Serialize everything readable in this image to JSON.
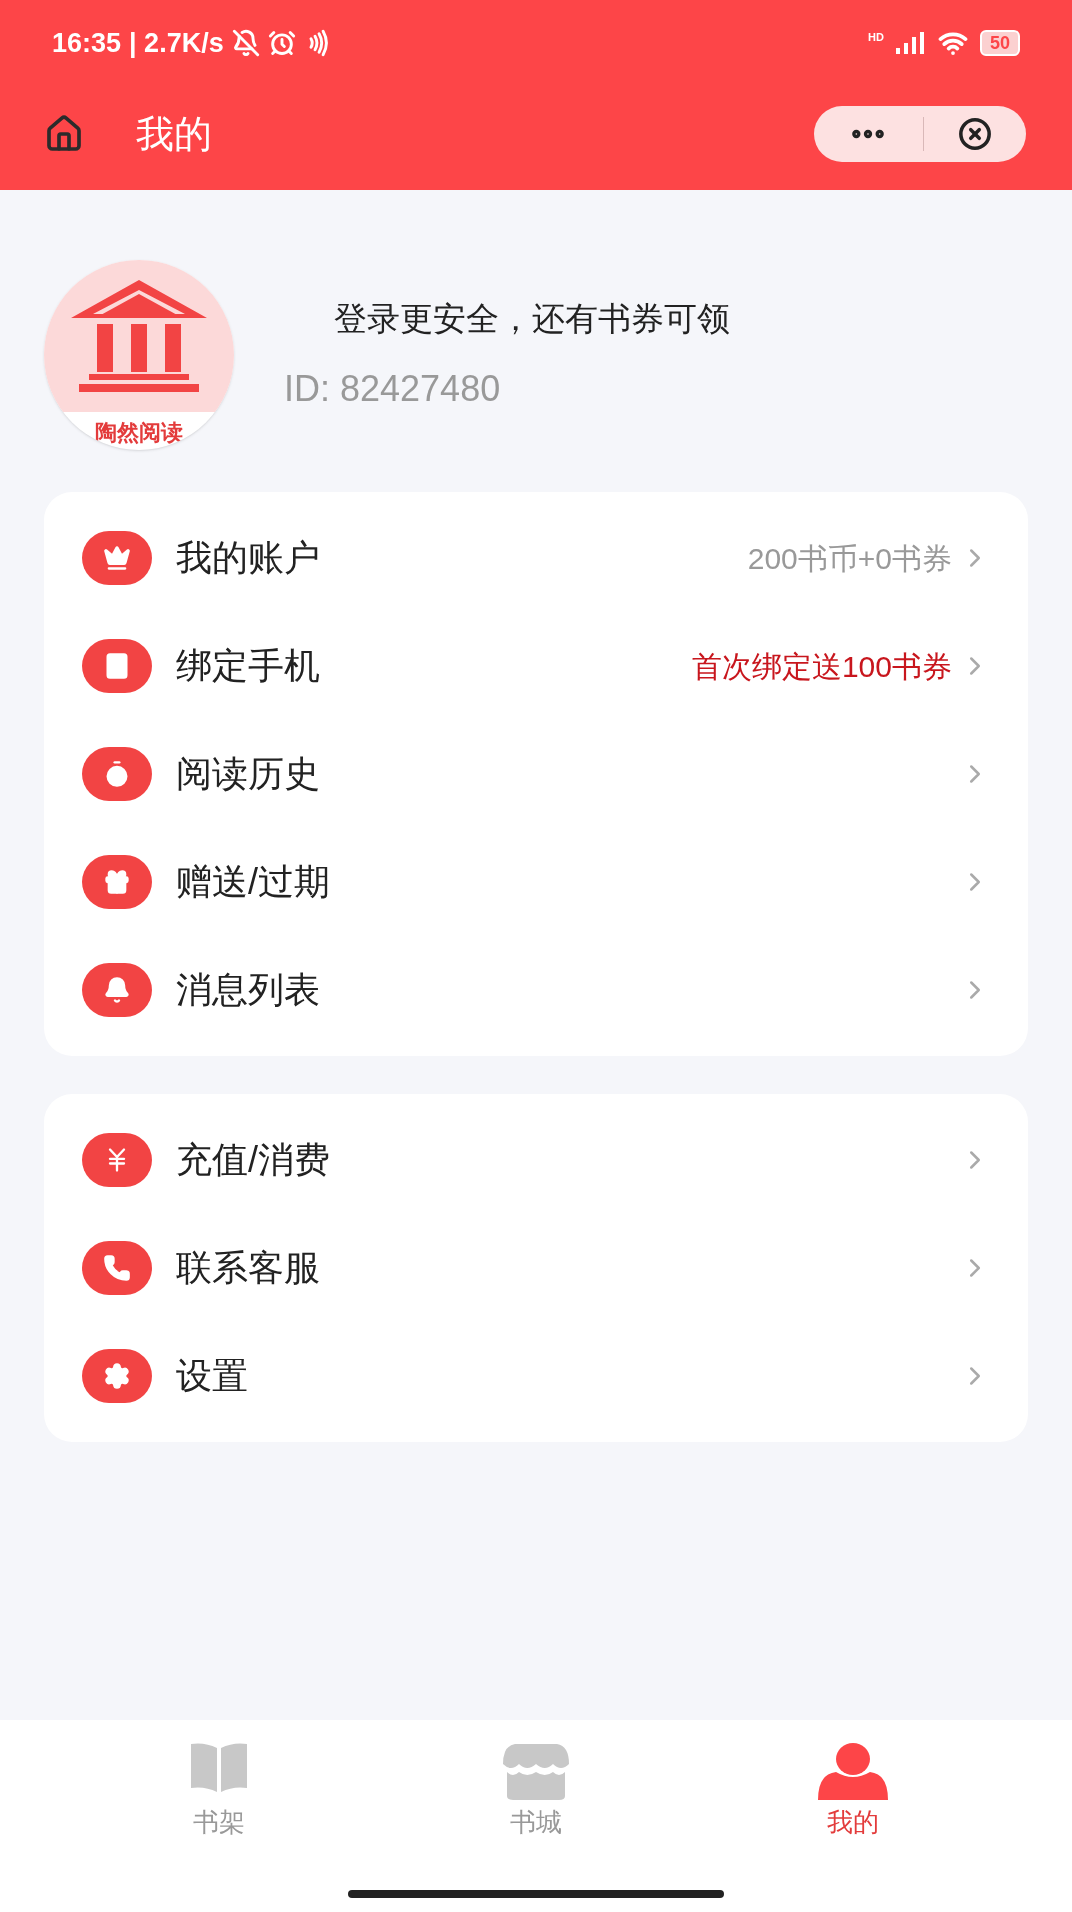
{
  "status_bar": {
    "time": "16:35",
    "speed": "| 2.7K/s",
    "network_badge": "HD",
    "battery": "50"
  },
  "nav": {
    "title": "我的"
  },
  "profile": {
    "logo_text": "陶然阅读",
    "prompt": "登录更安全，还有书券可领",
    "id": "ID: 82427480"
  },
  "groups": [
    {
      "items": [
        {
          "label": "我的账户",
          "detail": "200书币+0书券",
          "highlighted": false
        },
        {
          "label": "绑定手机",
          "detail": "首次绑定送100书券",
          "highlighted": true
        },
        {
          "label": "阅读历史"
        },
        {
          "label": "赠送/过期"
        },
        {
          "label": "消息列表"
        }
      ]
    },
    {
      "items": [
        {
          "label": "充值/消费"
        },
        {
          "label": "联系客服"
        },
        {
          "label": "设置"
        }
      ]
    }
  ],
  "tab_bar": [
    {
      "label": "书架",
      "selected": false
    },
    {
      "label": "书城",
      "selected": false
    },
    {
      "label": "我的",
      "selected": true
    }
  ]
}
